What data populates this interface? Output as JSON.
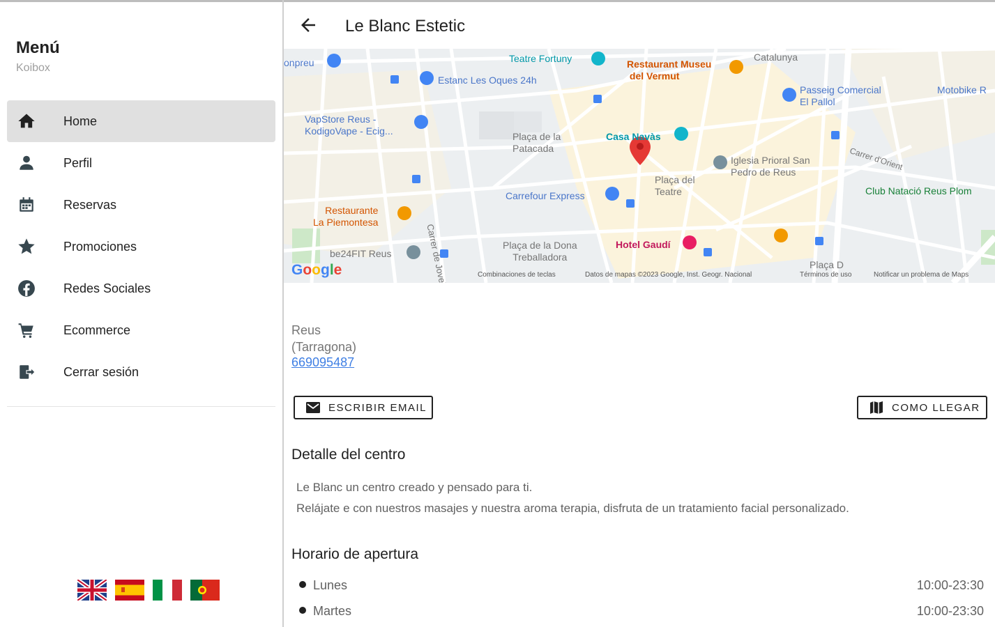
{
  "menu": {
    "title": "Menú",
    "subtitle": "Koibox",
    "items": [
      {
        "label": "Home",
        "icon": "home-icon",
        "active": true
      },
      {
        "label": "Perfil",
        "icon": "person-icon"
      },
      {
        "label": "Reservas",
        "icon": "calendar-icon"
      },
      {
        "label": "Promociones",
        "icon": "star-icon"
      },
      {
        "label": "Redes Sociales",
        "icon": "facebook-icon"
      },
      {
        "label": "Ecommerce",
        "icon": "cart-icon"
      },
      {
        "label": "Cerrar sesión",
        "icon": "logout-icon"
      }
    ],
    "languages": [
      "English",
      "Español",
      "Italiano",
      "Português"
    ]
  },
  "header": {
    "title": "Le Blanc Estetic"
  },
  "map": {
    "labels": {
      "teatre_fortuny": "Teatre Fortuny",
      "restaurant_museu": "Restaurant Museu\n del Vermut",
      "catalunya": "Catalunya",
      "estanc": "Estanc Les Oques 24h",
      "onpreu": "onpreu",
      "passeig": "Passeig Comercial\nEl Pallol",
      "motobike": "Motobike R",
      "vapstore": "VapStore Reus -\nKodigoVape - Ecig...",
      "placa_patacada": "Plaça de la\nPatacada",
      "casa_navas": "Casa Navàs",
      "iglesia": "Iglesia Prioral San\nPedro de Reus",
      "carrer_orient": "Carrer d'Orient",
      "club_natacio": "Club Natació Reus Plom",
      "carrefour": "Carrefour Express",
      "placa_teatre": "Plaça del\nTeatre",
      "restaurante_piemontesa": "Restaurante\nLa Piemontesa",
      "carrer_jovellar": "Carrer de Jovellar",
      "be24fit": "be24FIT Reus",
      "placa_dona": "Plaça de la Dona\nTreballadora",
      "hotel_gaudi": "Hotel Gaudí",
      "placa_d": "Plaça D"
    },
    "google": "Google",
    "footer": [
      "Combinaciones de teclas",
      "Datos de mapas ©2023 Google, Inst. Geogr. Nacional",
      "Términos de uso",
      "Notificar un problema de Maps"
    ]
  },
  "center": {
    "city": "Reus",
    "province": "(Tarragona)",
    "phone": "669095487",
    "email_button": "ESCRIBIR EMAIL",
    "directions_button": "COMO LLEGAR",
    "detail_title": "Detalle del centro",
    "description_line1": "Le Blanc un centro creado y pensado para ti.",
    "description_line2": "Relájate e con nuestros masajes y nuestra aroma terapia, disfruta de un tratamiento facial personalizado.",
    "hours_title": "Horario de apertura",
    "schedule": [
      {
        "day": "Lunes",
        "hours": "10:00-23:30"
      },
      {
        "day": "Martes",
        "hours": "10:00-23:30"
      }
    ]
  },
  "colors": {
    "accent_link": "#3f7fe4",
    "active_item_bg": "#e0e0e0",
    "map_pin": "#e53935"
  }
}
